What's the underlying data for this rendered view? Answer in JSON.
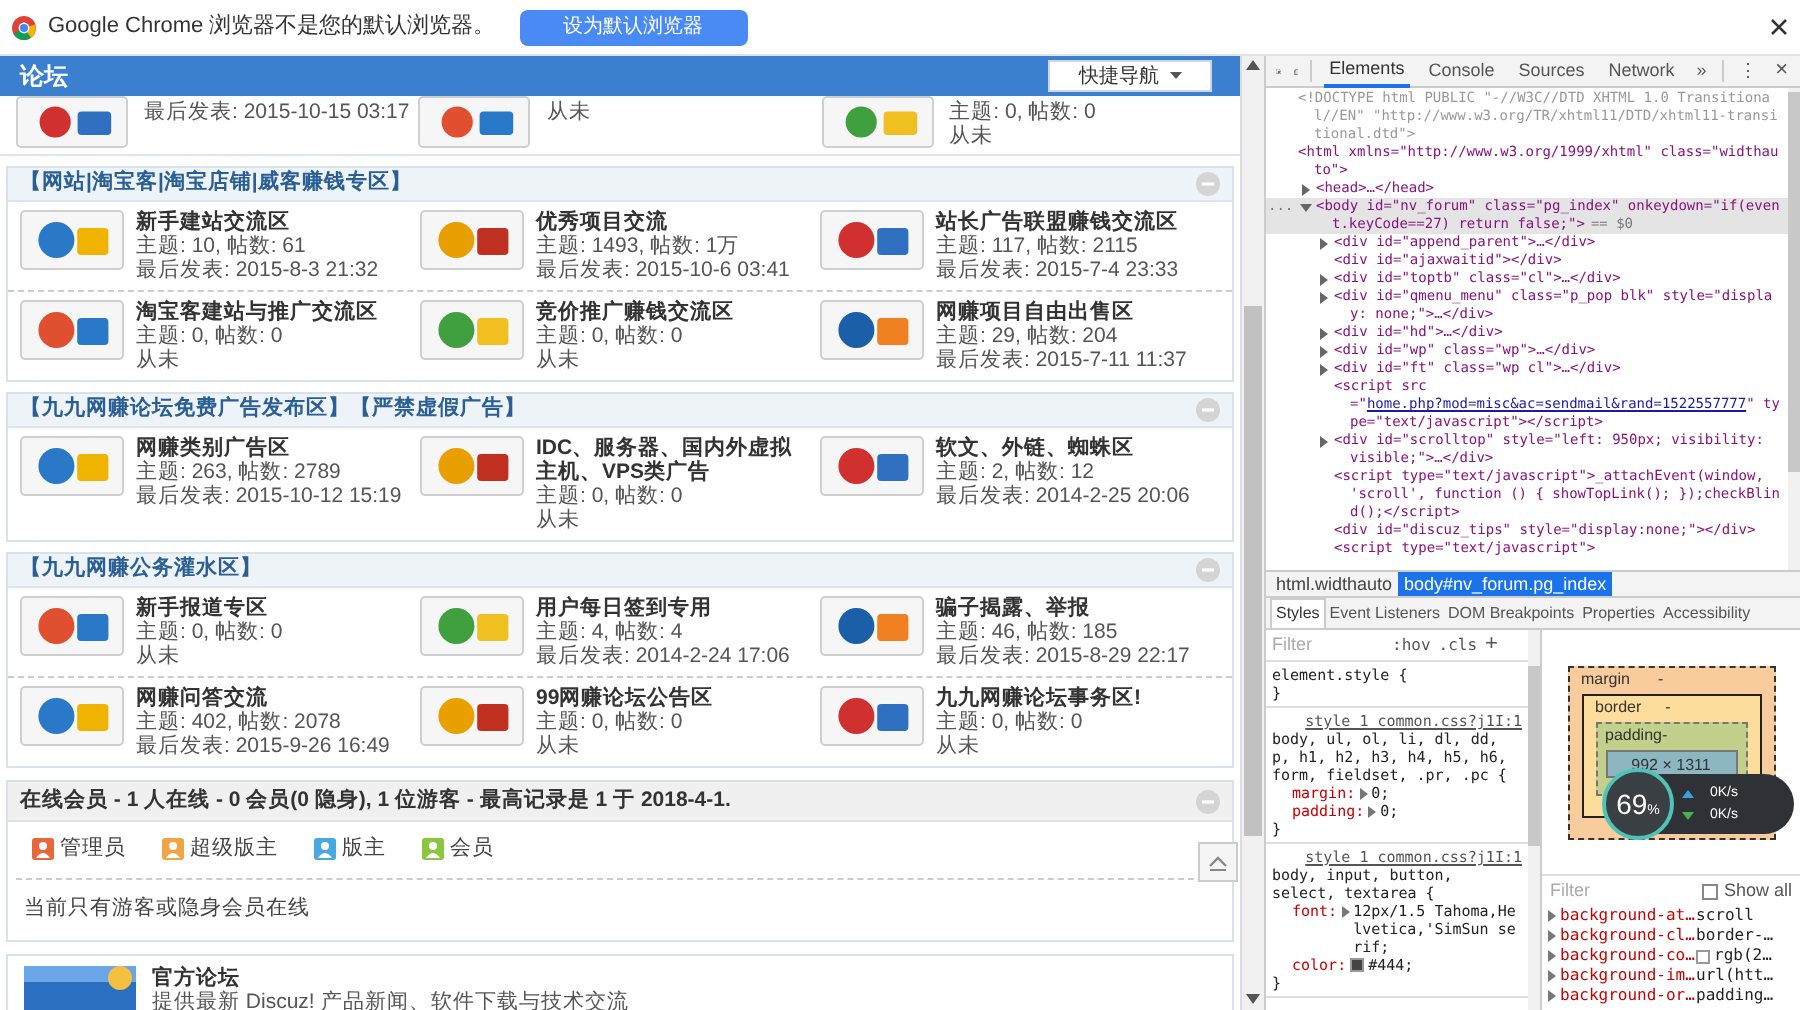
{
  "infobar": {
    "message": "Google Chrome 浏览器不是您的默认浏览器。",
    "button": "设为默认浏览器"
  },
  "page": {
    "header": {
      "title": "论坛",
      "quick_nav": "快捷导航"
    },
    "top_row": [
      {
        "lines": [
          "最后发表: 2015-10-15 03:17"
        ]
      },
      {
        "lines": [
          "从未"
        ]
      },
      {
        "lines": [
          "主题: 0, 帖数: 0",
          "从未"
        ]
      }
    ],
    "sections": [
      {
        "title": "【网站|淘宝客|淘宝店铺|威客赚钱专区】",
        "forums": [
          {
            "name": "新手建站交流区",
            "stats": "主题: 10, 帖数: 61",
            "last": "最后发表: 2015-8-3 21:32"
          },
          {
            "name": "优秀项目交流",
            "stats": "主题: 1493, 帖数: 1万",
            "last": "最后发表: 2015-10-6 03:41"
          },
          {
            "name": "站长广告联盟赚钱交流区",
            "stats": "主题: 117, 帖数: 2115",
            "last": "最后发表: 2015-7-4 23:33"
          },
          {
            "name": "淘宝客建站与推广交流区",
            "stats": "主题: 0, 帖数: 0",
            "last": "从未"
          },
          {
            "name": "竞价推广赚钱交流区",
            "stats": "主题: 0, 帖数: 0",
            "last": "从未"
          },
          {
            "name": "网赚项目自由出售区",
            "stats": "主题: 29, 帖数: 204",
            "last": "最后发表: 2015-7-11 11:37"
          }
        ]
      },
      {
        "title": "【九九网赚论坛免费广告发布区】【严禁虚假广告】",
        "forums": [
          {
            "name": "网赚类别广告区",
            "stats": "主题: 263, 帖数: 2789",
            "last": "最后发表: 2015-10-12 15:19"
          },
          {
            "name": "IDC、服务器、国内外虚拟主机、VPS类广告",
            "stats": "主题: 0, 帖数: 0",
            "last": "从未"
          },
          {
            "name": "软文、外链、蜘蛛区",
            "stats": "主题: 2, 帖数: 12",
            "last": "最后发表: 2014-2-25 20:06"
          }
        ]
      },
      {
        "title": "【九九网赚公务灌水区】",
        "forums": [
          {
            "name": "新手报道专区",
            "stats": "主题: 0, 帖数: 0",
            "last": "从未"
          },
          {
            "name": "用户每日签到专用",
            "stats": "主题: 4, 帖数: 4",
            "last": "最后发表: 2014-2-24 17:06"
          },
          {
            "name": "骗子揭露、举报",
            "stats": "主题: 46, 帖数: 185",
            "last": "最后发表: 2015-8-29 22:17"
          },
          {
            "name": "网赚问答交流",
            "stats": "主题: 402, 帖数: 2078",
            "last": "最后发表: 2015-9-26 16:49"
          },
          {
            "name": "99网赚论坛公告区",
            "stats": "主题: 0, 帖数: 0",
            "last": "从未"
          },
          {
            "name": "九九网赚论坛事务区!",
            "stats": "主题: 0, 帖数: 0",
            "last": "从未"
          }
        ]
      }
    ],
    "online": {
      "title": "在线会员 - 1 人在线 - 0 会员(0 隐身), 1 位游客 - 最高记录是 1 于 2018-4-1.",
      "legend": [
        {
          "label": "管理员",
          "color": "#e8663a"
        },
        {
          "label": "超级版主",
          "color": "#f0a545"
        },
        {
          "label": "版主",
          "color": "#4aa8e0"
        },
        {
          "label": "会员",
          "color": "#8cc63f"
        }
      ],
      "note": "当前只有游客或隐身会员在线"
    },
    "card": {
      "title": "官方论坛",
      "description": "提供最新 Discuz! 产品新闻、软件下载与技术交流"
    }
  },
  "devtools": {
    "tabs": [
      {
        "label": "Elements",
        "selected": true
      },
      {
        "label": "Console",
        "selected": false
      },
      {
        "label": "Sources",
        "selected": false
      },
      {
        "label": "Network",
        "selected": false
      }
    ],
    "more": "»",
    "menu": "⋮",
    "close": "×",
    "dom": [
      {
        "kind": "doctype",
        "selected": false,
        "text": "<!DOCTYPE html PUBLIC \"-//W3C//DTD XHTML 1.0 Transitional//EN\" \"http://www.w3.org/TR/xhtml11/DTD/xhtml11-transitional.dtd\">"
      },
      {
        "kind": "tag",
        "selected": false,
        "text": "<html xmlns=\"http://www.w3.org/1999/xhtml\" class=\"widthauto\">",
        "children": [
          {
            "kind": "tag",
            "selected": false,
            "expanded": false,
            "text": "<head>…</head>"
          },
          {
            "kind": "tag",
            "selected": true,
            "expanded": true,
            "prefix": "...",
            "marker": "== $0",
            "text": "<body id=\"nv_forum\" class=\"pg_index\" onkeydown=\"if(event.keyCode==27) return false;\">",
            "children": [
              {
                "kind": "tag",
                "selected": false,
                "expanded": false,
                "text": "<div id=\"append_parent\">…</div>"
              },
              {
                "kind": "tag",
                "selected": false,
                "text": "<div id=\"ajaxwaitid\"></div>"
              },
              {
                "kind": "tag",
                "selected": false,
                "expanded": false,
                "text": "<div id=\"toptb\" class=\"cl\">…</div>"
              },
              {
                "kind": "tag",
                "selected": false,
                "expanded": false,
                "text": "<div id=\"qmenu_menu\" class=\"p_pop blk\" style=\"display: none;\">…</div>"
              },
              {
                "kind": "tag",
                "selected": false,
                "expanded": false,
                "text": "<div id=\"hd\">…</div>"
              },
              {
                "kind": "tag",
                "selected": false,
                "expanded": false,
                "text": "<div id=\"wp\" class=\"wp\">…</div>"
              },
              {
                "kind": "tag",
                "selected": false,
                "expanded": false,
                "text": "<div id=\"ft\" class=\"wp cl\">…</div>"
              },
              {
                "kind": "link",
                "selected": false,
                "text": "<script src=\"",
                "link": "home.php?mod=misc&ac=sendmail&rand=1522557777",
                "after": "\" type=\"text/javascript\"></script>"
              },
              {
                "kind": "tag",
                "selected": false,
                "expanded": false,
                "text": "<div id=\"scrolltop\" style=\"left: 950px; visibility: visible;\">…</div>"
              },
              {
                "kind": "tag",
                "selected": false,
                "text": "<script type=\"text/javascript\">_attachEvent(window, 'scroll', function () { showTopLink(); });checkBlind();</script>"
              },
              {
                "kind": "tag",
                "selected": false,
                "text": "<div id=\"discuz_tips\" style=\"display:none;\"></div>"
              },
              {
                "kind": "tag",
                "selected": false,
                "text": "<script type=\"text/javascript\">"
              }
            ]
          }
        ]
      }
    ],
    "breadcrumb": [
      {
        "label": "html.widthauto",
        "selected": false
      },
      {
        "label": "body#nv_forum.pg_index",
        "selected": true
      }
    ],
    "subtabs": [
      {
        "label": "Styles",
        "selected": true
      },
      {
        "label": "Event Listeners",
        "selected": false
      },
      {
        "label": "DOM Breakpoints",
        "selected": false
      },
      {
        "label": "Properties",
        "selected": false
      },
      {
        "label": "Accessibility",
        "selected": false
      }
    ],
    "styles": {
      "filter": {
        "placeholder": "Filter"
      },
      "hov": ":hov",
      "cls": ".cls",
      "add": "+",
      "rules": [
        {
          "selector": "element.style {",
          "end": "}"
        },
        {
          "selector": "body, ul, ol, li, dl, dd, p, h1, h2, h3, h4, h5, h6, form, fieldset, .pr, .pc {",
          "source": "style_1_common.css?j1I:1",
          "props": [
            {
              "kind": "shorthand",
              "name": "margin:",
              "value": "0;"
            },
            {
              "kind": "shorthand",
              "name": "padding:",
              "value": "0;"
            }
          ],
          "end": "}"
        },
        {
          "selector": "body, input, button, select, textarea {",
          "source": "style_1_common.css?j1I:1",
          "props": [
            {
              "kind": "shorthand",
              "name": "font:",
              "value": "12px/1.5 Tahoma,Helvetica,'SimSun serif;"
            },
            {
              "kind": "color",
              "name": "color:",
              "value": "#444;",
              "color": "#444444"
            }
          ],
          "end": "}"
        }
      ]
    },
    "box_model": {
      "margin": "margin",
      "margin_value": "-",
      "border": "border",
      "border_value": "-",
      "padding": "padding",
      "padding_value": "-",
      "content": "992 × 1311"
    },
    "speed_widget": {
      "percent": "69",
      "unit": "%",
      "upload": "0K/s",
      "download": "0K/s"
    },
    "computed": {
      "filter": {
        "placeholder": "Filter"
      },
      "show_all": {
        "label": "Show all",
        "checked": false
      },
      "props": [
        {
          "name": "background-at…",
          "value": "scroll"
        },
        {
          "name": "background-cl…",
          "value": "border-…"
        },
        {
          "name": "background-co…",
          "value": "rgb(2…",
          "color": "#ffffff"
        },
        {
          "name": "background-im…",
          "value": "url(htt…"
        },
        {
          "name": "background-or…",
          "value": "padding…"
        }
      ]
    }
  }
}
